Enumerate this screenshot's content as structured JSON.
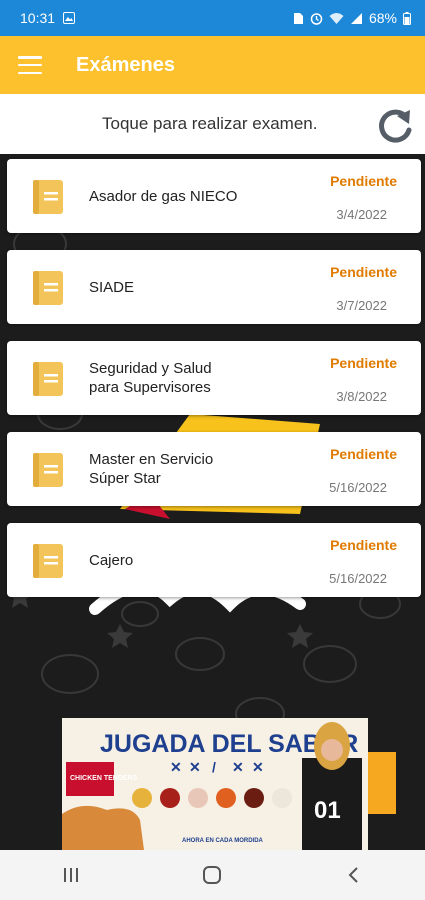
{
  "status_bar": {
    "time": "10:31",
    "battery": "68%"
  },
  "app_bar": {
    "title": "Exámenes"
  },
  "hint": {
    "text": "Toque para realizar examen."
  },
  "exams": [
    {
      "title": "Asador de gas NIECO",
      "status": "Pendiente",
      "date": "3/4/2022"
    },
    {
      "title": "SIADE",
      "status": "Pendiente",
      "date": "3/7/2022"
    },
    {
      "title": "Seguridad y Salud para Supervisores",
      "status": "Pendiente",
      "date": "3/8/2022"
    },
    {
      "title": "Master en  Servicio Súper Star",
      "status": "Pendiente",
      "date": "5/16/2022"
    },
    {
      "title": "Cajero",
      "status": "Pendiente",
      "date": "5/16/2022"
    }
  ],
  "ad": {
    "headline": "JUGADA DEL SABOR",
    "product": "CHICKEN TENDERS",
    "footer": "AHORA EN CADA MORDIDA",
    "jersey": "01"
  },
  "colors": {
    "status_bar": "#1e88d8",
    "app_bar": "#fcc12d",
    "pending": "#e07b00",
    "book": "#f2c45a"
  }
}
